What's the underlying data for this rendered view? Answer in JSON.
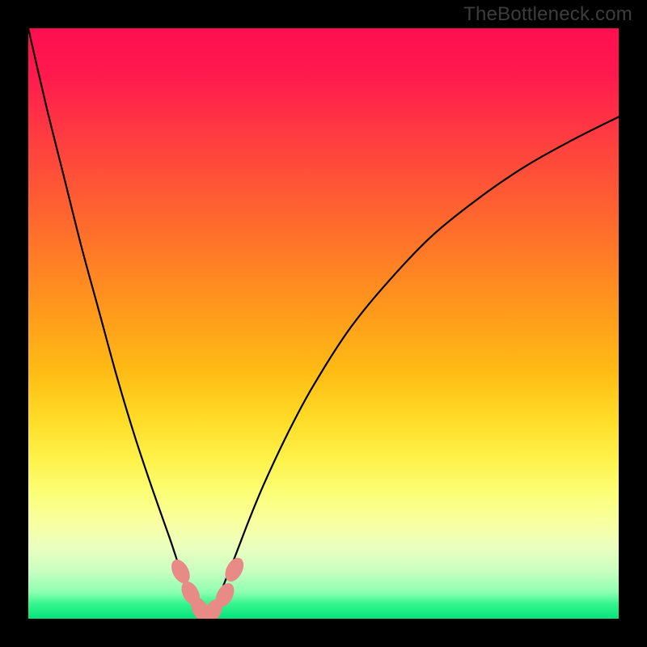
{
  "watermark": "TheBottleneck.com",
  "colors": {
    "frame_bg": "#000000",
    "watermark_text": "#3d3d3d",
    "curve_stroke": "#000000",
    "marker_fill": "#e88b87",
    "gradient_stops": [
      "#ff0e4f",
      "#ff1a4e",
      "#ff3b41",
      "#ff5a34",
      "#ff7a27",
      "#ff9a1c",
      "#ffbb14",
      "#ffdb26",
      "#fef24a",
      "#fcff79",
      "#f8ffa3",
      "#eaffbf",
      "#c8ffc1",
      "#8dffb0",
      "#35f58e",
      "#05e37c"
    ]
  },
  "chart_data": {
    "type": "line",
    "title": "",
    "xlabel": "",
    "ylabel": "",
    "xlim": [
      0,
      100
    ],
    "ylim": [
      0,
      100
    ],
    "grid": false,
    "legend": false,
    "note": "Axes are unlabeled in the source image; values are estimated from pixel coordinates on a 0–100 normalized scale. y=0 is bottom edge (green), y=100 is top edge (red).",
    "series": [
      {
        "name": "left-branch",
        "x": [
          0.0,
          3.0,
          6.0,
          9.0,
          12.0,
          15.0,
          18.0,
          21.0,
          24.0,
          25.5,
          27.0,
          28.5,
          30.0
        ],
        "y": [
          100.0,
          87.0,
          75.0,
          63.0,
          52.0,
          41.0,
          31.0,
          22.0,
          13.5,
          9.0,
          5.0,
          2.0,
          0.0
        ]
      },
      {
        "name": "right-branch",
        "x": [
          30.0,
          31.5,
          33.0,
          35.0,
          37.5,
          40.0,
          44.0,
          48.0,
          54.0,
          60.0,
          68.0,
          76.0,
          84.0,
          92.0,
          100.0
        ],
        "y": [
          0.0,
          2.0,
          5.5,
          10.5,
          17.0,
          23.0,
          31.5,
          39.0,
          48.5,
          56.0,
          64.5,
          71.0,
          76.5,
          81.0,
          85.0
        ]
      }
    ],
    "markers": {
      "note": "Pink rounded-blob markers clustered at the valley bottom",
      "points": [
        {
          "x": 25.8,
          "y": 8.0
        },
        {
          "x": 27.5,
          "y": 4.3
        },
        {
          "x": 29.1,
          "y": 1.6
        },
        {
          "x": 31.3,
          "y": 1.3
        },
        {
          "x": 33.3,
          "y": 4.0
        },
        {
          "x": 34.9,
          "y": 8.3
        }
      ],
      "radius_pct": 1.4
    }
  }
}
